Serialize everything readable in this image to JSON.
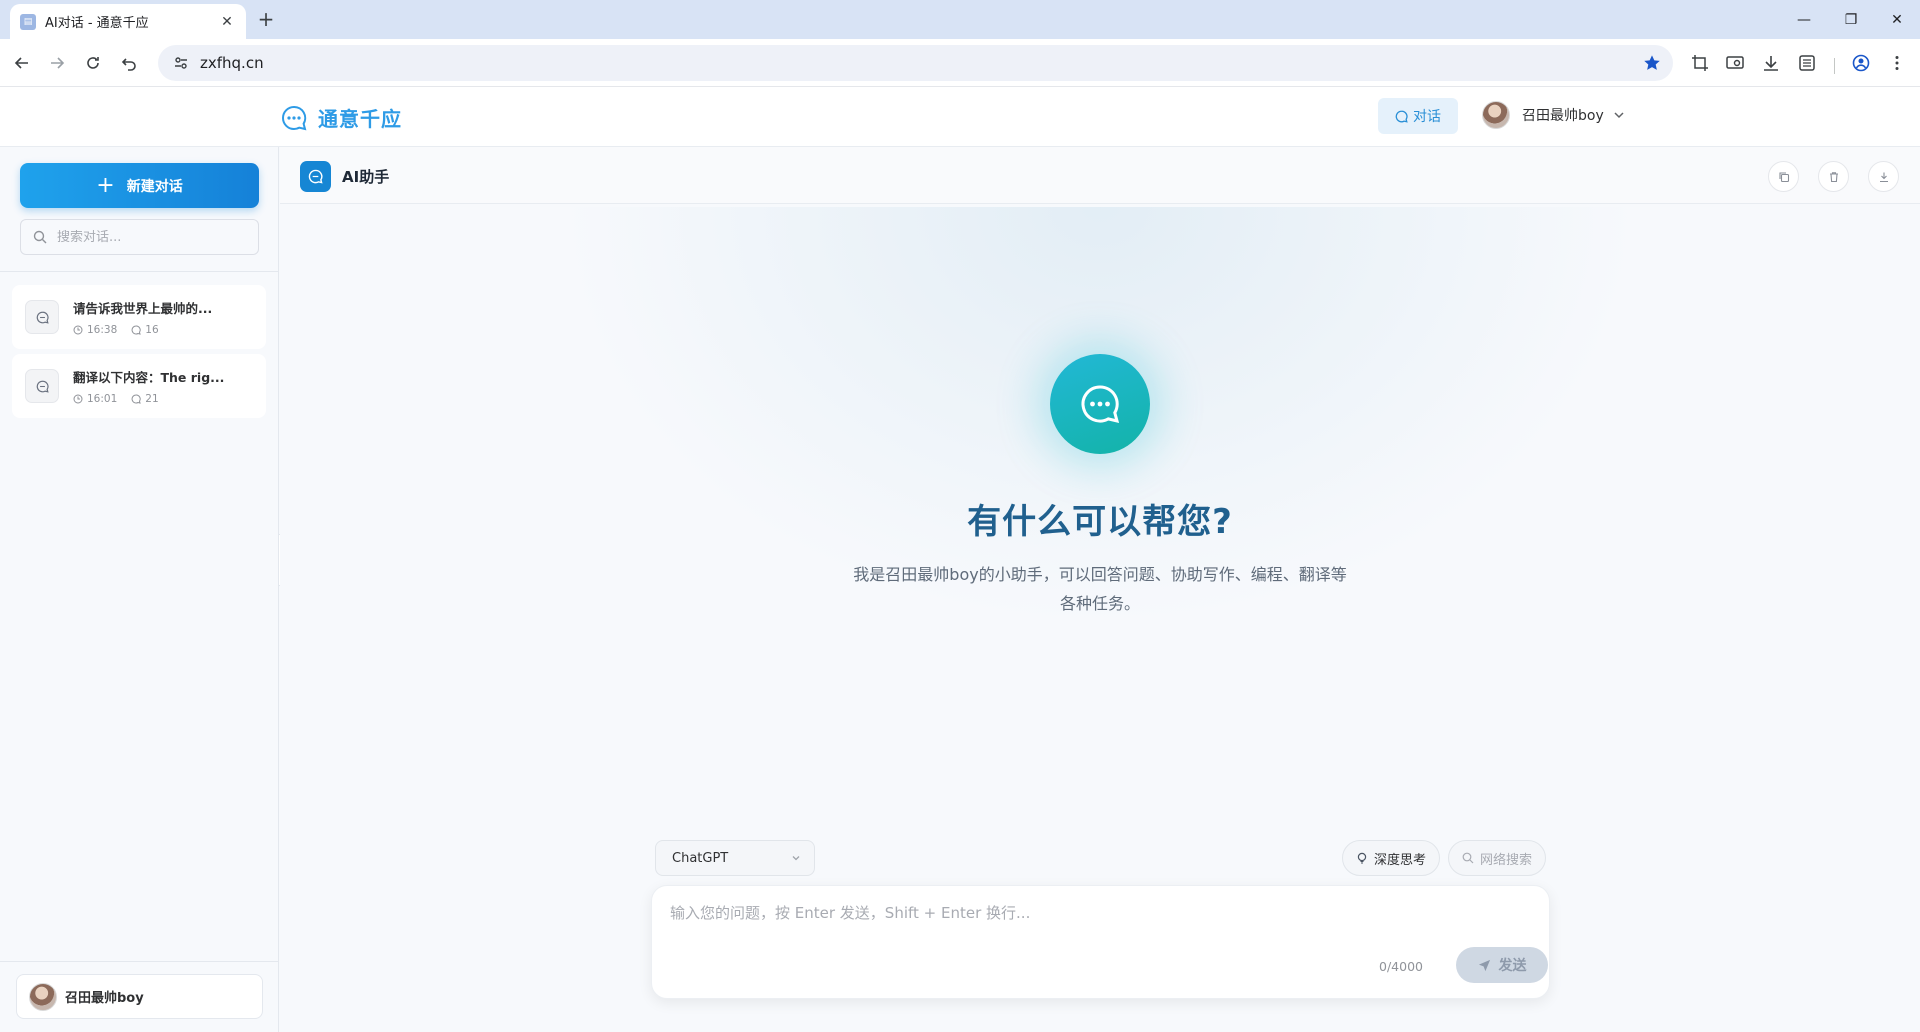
{
  "browser": {
    "tab_title": "AI对话 - 通意千应",
    "url": "zxfhq.cn"
  },
  "header": {
    "brand_name": "通意千应",
    "chat_button_label": "对话",
    "user_name": "召田最帅boy"
  },
  "sidebar": {
    "new_chat_label": "新建对话",
    "search_placeholder": "搜索对话...",
    "conversations": [
      {
        "title": "请告诉我世界上最帅的...",
        "time": "16:38",
        "count": "16"
      },
      {
        "title": "翻译以下内容：The rig...",
        "time": "16:01",
        "count": "21"
      }
    ],
    "user_name": "召田最帅boy"
  },
  "chat": {
    "title": "AI助手",
    "hero_title": "有什么可以帮您?",
    "hero_subtitle": "我是召田最帅boy的小助手，可以回答问题、协助写作、编程、翻译等各种任务。",
    "model": "ChatGPT",
    "deep_think_label": "深度思考",
    "web_search_label": "网络搜索",
    "input_placeholder": "输入您的问题，按 Enter 发送，Shift + Enter 换行...",
    "char_count": "0/4000",
    "send_label": "发送"
  },
  "colors": {
    "brand": "#2e9be6",
    "accent": "#1686d4",
    "hero_gradient_start": "#22b8d6",
    "hero_gradient_end": "#13b3a8",
    "hero_title": "#20608e"
  }
}
